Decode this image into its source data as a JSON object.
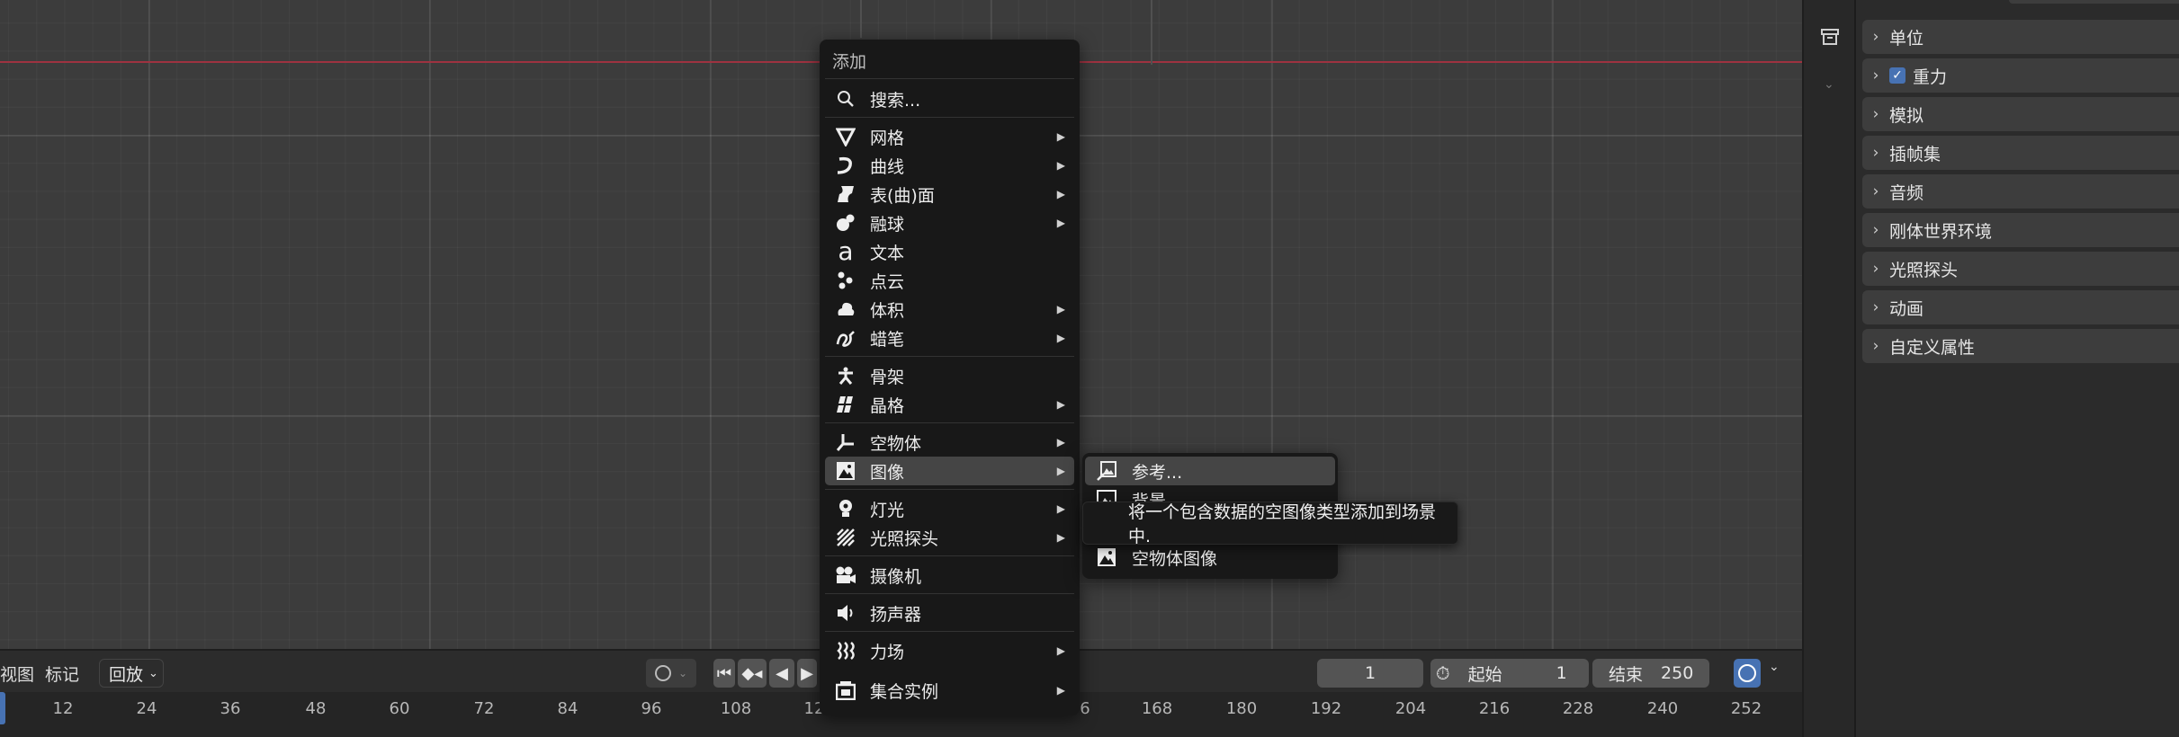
{
  "menu": {
    "title": "添加",
    "items": [
      {
        "label": "搜索...",
        "icon": "search-icon",
        "submenu": false
      },
      {
        "label": "网格",
        "icon": "mesh-icon",
        "submenu": true
      },
      {
        "label": "曲线",
        "icon": "curve-icon",
        "submenu": true
      },
      {
        "label": "表(曲)面",
        "icon": "surface-icon",
        "submenu": true
      },
      {
        "label": "融球",
        "icon": "metaball-icon",
        "submenu": true
      },
      {
        "label": "文本",
        "icon": "text-icon",
        "submenu": false
      },
      {
        "label": "点云",
        "icon": "pointcloud-icon",
        "submenu": false
      },
      {
        "label": "体积",
        "icon": "volume-icon",
        "submenu": true
      },
      {
        "label": "蜡笔",
        "icon": "grease-pencil-icon",
        "submenu": true
      },
      {
        "label": "骨架",
        "icon": "armature-icon",
        "submenu": false
      },
      {
        "label": "晶格",
        "icon": "lattice-icon",
        "submenu": true
      },
      {
        "label": "空物体",
        "icon": "empty-icon",
        "submenu": true
      },
      {
        "label": "图像",
        "icon": "image-icon",
        "submenu": true
      },
      {
        "label": "灯光",
        "icon": "light-icon",
        "submenu": true
      },
      {
        "label": "光照探头",
        "icon": "lightprobe-icon",
        "submenu": true
      },
      {
        "label": "摄像机",
        "icon": "camera-icon",
        "submenu": false
      },
      {
        "label": "扬声器",
        "icon": "speaker-icon",
        "submenu": false
      },
      {
        "label": "力场",
        "icon": "forcefield-icon",
        "submenu": true
      },
      {
        "label": "集合实例",
        "icon": "collection-instance-icon",
        "submenu": true
      }
    ]
  },
  "image_submenu": {
    "items": [
      {
        "label": "参考...",
        "icon": "image-reference-icon"
      },
      {
        "label": "背景",
        "icon": "image-background-icon"
      },
      {
        "label": "",
        "icon": "image-plane-icon"
      },
      {
        "label": "空物体图像",
        "icon": "image-empty-icon"
      }
    ]
  },
  "tooltip": {
    "text": "将一个包含数据的空图像类型添加到场景中."
  },
  "properties": {
    "rows": [
      {
        "label": "单位",
        "checkbox": false
      },
      {
        "label": "重力",
        "checkbox": true
      },
      {
        "label": "模拟",
        "checkbox": false
      },
      {
        "label": "插帧集",
        "checkbox": false
      },
      {
        "label": "音频",
        "checkbox": false
      },
      {
        "label": "刚体世界环境",
        "checkbox": false
      },
      {
        "label": "光照探头",
        "checkbox": false
      },
      {
        "label": "动画",
        "checkbox": false
      },
      {
        "label": "自定义属性",
        "checkbox": false
      }
    ]
  },
  "timeline": {
    "menu_view": "视图",
    "menu_marker": "标记",
    "playback": "回放",
    "current_frame": "1",
    "start_label": "起始",
    "start_value": "1",
    "end_label": "结束",
    "end_value": "250",
    "ticks": [
      "12",
      "24",
      "36",
      "48",
      "60",
      "72",
      "84",
      "96",
      "108",
      "12",
      "6",
      "168",
      "180",
      "192",
      "204",
      "216",
      "228",
      "240",
      "252"
    ]
  },
  "colors": {
    "accent": "#4772b3",
    "x_axis": "#9e3240",
    "menu_bg": "#181818"
  }
}
